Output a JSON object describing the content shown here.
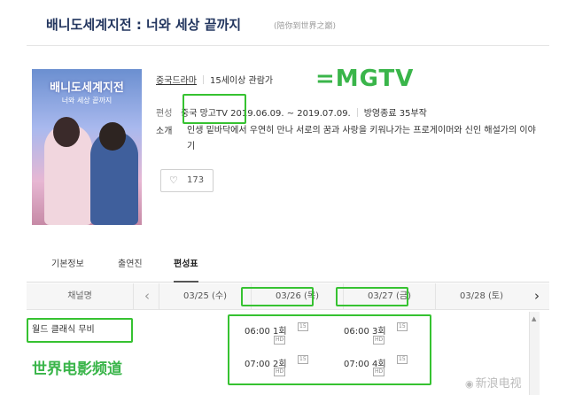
{
  "header": {
    "title": "배니도세계지전 : 너와 세상 끝까지",
    "subtitle": "(陪你到世界之巅)"
  },
  "poster": {
    "title": "배니도세계지전",
    "subtitle": "너와 세상 끝까지"
  },
  "info": {
    "genre": "중국드라마",
    "rating": "15세이상 관람가",
    "broadcast_label": "편성",
    "channel": "중국 망고TV",
    "period": "2019.06.09. ~ 2019.07.09.",
    "status": "방영종료 35부작",
    "summary_label": "소개",
    "summary": "인생 밑바닥에서 우연히 만나 서로의 꿈과 사랑을 키워나가는 프로게이머와 신인 해설가의 이야기"
  },
  "like": {
    "count": "173",
    "icon": "heart-icon"
  },
  "annotations": {
    "mgtv": "=MGTV",
    "chinese_channel": "世界电影频道",
    "color": "#3ab54a"
  },
  "tabs": [
    {
      "label": "기본정보",
      "active": false
    },
    {
      "label": "출연진",
      "active": false
    },
    {
      "label": "편성표",
      "active": true
    }
  ],
  "schedule": {
    "channel_header": "채널명",
    "prev_icon": "chevron-left-icon",
    "next_icon": "chevron-right-icon",
    "dates": [
      "03/25 (수)",
      "03/26 (목)",
      "03/27 (금)",
      "03/28 (토)"
    ],
    "channel": "월드 클래식 무비",
    "slots": [
      {
        "time": "06:00",
        "episode": "1회",
        "rating_badge": "15",
        "hd_badge": "HD"
      },
      {
        "time": "06:00",
        "episode": "3회",
        "rating_badge": "15",
        "hd_badge": "HD"
      },
      {
        "time": "07:00",
        "episode": "2회",
        "rating_badge": "15",
        "hd_badge": "HD"
      },
      {
        "time": "07:00",
        "episode": "4회",
        "rating_badge": "15",
        "hd_badge": "HD"
      }
    ]
  },
  "watermark": {
    "icon": "weibo-icon",
    "text": "新浪电视"
  },
  "colors": {
    "title": "#22355e",
    "highlight_box": "#36c231"
  }
}
